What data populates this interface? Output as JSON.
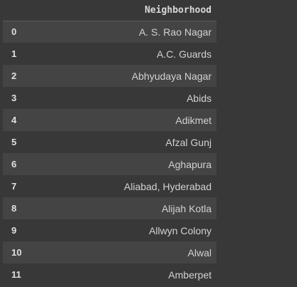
{
  "table": {
    "column_header": "Neighborhood",
    "rows": [
      {
        "index": "0",
        "neighborhood": "A. S. Rao Nagar"
      },
      {
        "index": "1",
        "neighborhood": "A.C. Guards"
      },
      {
        "index": "2",
        "neighborhood": "Abhyudaya Nagar"
      },
      {
        "index": "3",
        "neighborhood": "Abids"
      },
      {
        "index": "4",
        "neighborhood": "Adikmet"
      },
      {
        "index": "5",
        "neighborhood": "Afzal Gunj"
      },
      {
        "index": "6",
        "neighborhood": "Aghapura"
      },
      {
        "index": "7",
        "neighborhood": "Aliabad, Hyderabad"
      },
      {
        "index": "8",
        "neighborhood": "Alijah Kotla"
      },
      {
        "index": "9",
        "neighborhood": "Allwyn Colony"
      },
      {
        "index": "10",
        "neighborhood": "Alwal"
      },
      {
        "index": "11",
        "neighborhood": "Amberpet"
      }
    ]
  },
  "colors": {
    "background": "#383838",
    "row_stripe": "#444444",
    "text": "#d2d2d2"
  }
}
